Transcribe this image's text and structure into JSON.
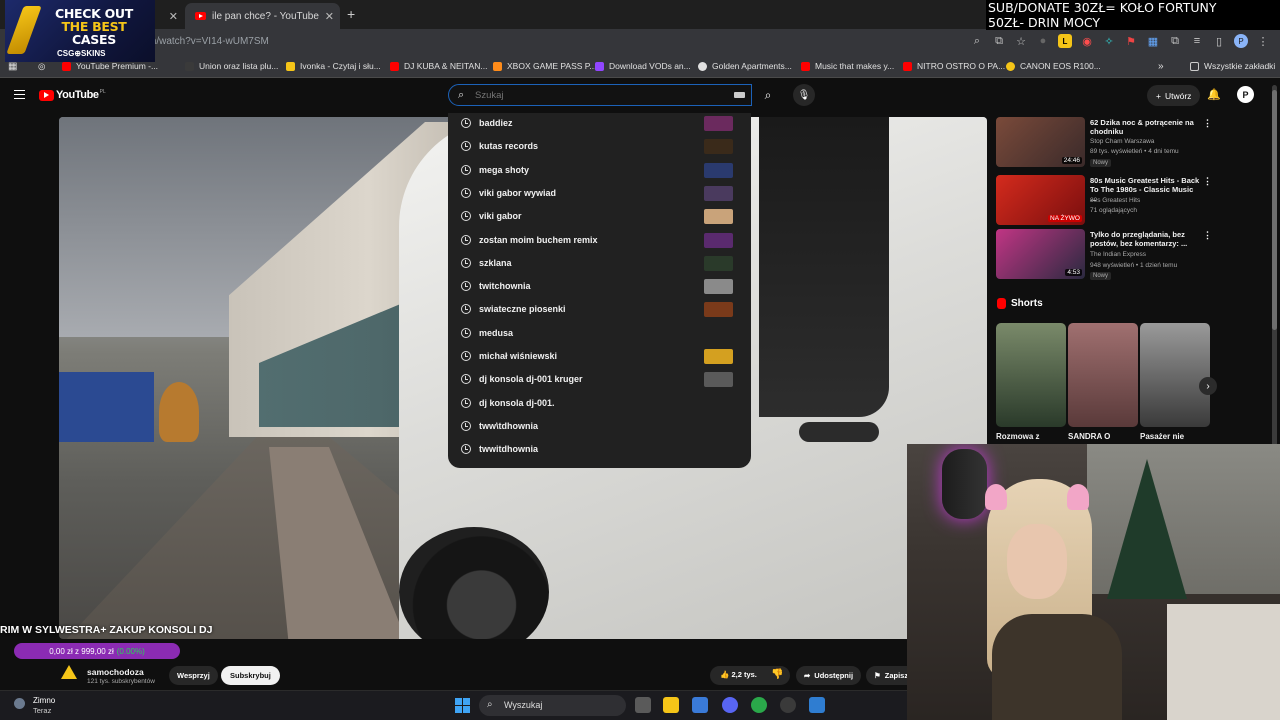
{
  "browser": {
    "tabs": [
      {
        "title": "ile pan chce? - YouTube",
        "active": true
      }
    ],
    "url": "m/watch?v=VI14-wUM7SM",
    "bookmarks": [
      {
        "label": "YouTube Premium -...",
        "color": "#ff0000"
      },
      {
        "label": "Union oraz lista plu...",
        "color": "#3a3a3a"
      },
      {
        "label": "Ivonka - Czytaj i słu...",
        "color": "#f5c518"
      },
      {
        "label": "DJ KUBA & NEITAN...",
        "color": "#ff0000"
      },
      {
        "label": "XBOX GAME PASS P...",
        "color": "#ff8c1a"
      },
      {
        "label": "Download VODs an...",
        "color": "#9146ff"
      },
      {
        "label": "Golden Apartments...",
        "color": "#e0e0e0"
      },
      {
        "label": "Music that makes y...",
        "color": "#ff0000"
      },
      {
        "label": "NITRO OSTRO O PA...",
        "color": "#ff0000"
      },
      {
        "label": "CANON EOS R100...",
        "color": "#f5c518"
      }
    ],
    "all_bookmarks": "Wszystkie zakładki"
  },
  "overlays": {
    "promo": {
      "line1": "CHECK OUT",
      "line2": "THE BEST",
      "line3": "CASES",
      "logo": "CSG⊕SKINS"
    },
    "donate": {
      "line1": "SUB/DONATE 30ZŁ= KOŁO FORTUNY",
      "line2": "50ZŁ- DRIN MOCY"
    }
  },
  "youtube": {
    "logo": "YouTube",
    "region": "PL",
    "search_placeholder": "Szukaj",
    "create_label": "Utwórz",
    "suggestions": [
      {
        "text": "baddiez",
        "thumb": "#6b2a5e"
      },
      {
        "text": "kutas records",
        "thumb": "#3a2a1a"
      },
      {
        "text": "mega shoty",
        "thumb": "#2a3a6e"
      },
      {
        "text": "viki gabor wywiad",
        "thumb": "#4a3a5e"
      },
      {
        "text": "viki gabor",
        "thumb": "#c9a37a"
      },
      {
        "text": "zostan moim buchem remix",
        "thumb": "#5a2a6e"
      },
      {
        "text": "szklana",
        "thumb": "#2a3a2a"
      },
      {
        "text": "twitchownia",
        "thumb": "#8a8a8a"
      },
      {
        "text": "swiateczne piosenki",
        "thumb": "#7a3a1a"
      },
      {
        "text": "medusa",
        "thumb": null
      },
      {
        "text": "michał wiśniewski",
        "thumb": "#d4a020"
      },
      {
        "text": "dj konsola dj-001 kruger",
        "thumb": "#5a5a5a"
      },
      {
        "text": "dj konsola dj-001.",
        "thumb": null
      },
      {
        "text": "tww\\tdhownia",
        "thumb": null
      },
      {
        "text": "twwitdhownia",
        "thumb": null
      }
    ],
    "video_title": "RIM W SYLWESTRA+ ZAKUP KONSOLI DJ",
    "goal": {
      "text": "0,00 zł z 999,00 zł",
      "percent": "(0.00%)",
      "fraction": 0.0
    },
    "channel": {
      "name": "samochodoza",
      "subs": "121 tys. subskrybentów"
    },
    "support_label": "Wesprzyj",
    "subscribe_label": "Subskrybuj",
    "likes": "2,2 tys.",
    "share_label": "Udostępnij",
    "save_label": "Zapisz",
    "recommendations": [
      {
        "title": "62 Dzika noc & potrącenie na chodniku",
        "channel": "Stop Cham Warszawa",
        "meta": "89 tys. wyświetleń • 4 dni temu",
        "badge": "Nowy",
        "duration": "24:46",
        "thumb": "#5a3a2a"
      },
      {
        "title": "80s Music Greatest Hits - Back To The 1980s - Classic Music ...",
        "channel": "80s Greatest Hits",
        "meta": "71 oglądających",
        "badge": "NA ŻYWO",
        "duration": "",
        "thumb": "#c81d1d"
      },
      {
        "title": "Tylko do przeglądania, bez postów, bez komentarzy: ...",
        "channel": "The Indian Express",
        "meta": "948 wyświetleń • 1 dzień temu",
        "badge": "Nowy",
        "duration": "4:53",
        "thumb": "#8a2a8a"
      }
    ],
    "shorts_heading": "Shorts",
    "shorts": [
      {
        "label": "Rozmowa z",
        "thumb": "#4a5a3a"
      },
      {
        "label": "SANDRA O",
        "thumb": "#6a4a4a"
      },
      {
        "label": "Pasażer nie",
        "thumb": "#5a5a5a"
      }
    ]
  },
  "taskbar": {
    "weather_title": "Zimno",
    "weather_sub": "Teraz",
    "search_label": "Wyszukaj"
  }
}
